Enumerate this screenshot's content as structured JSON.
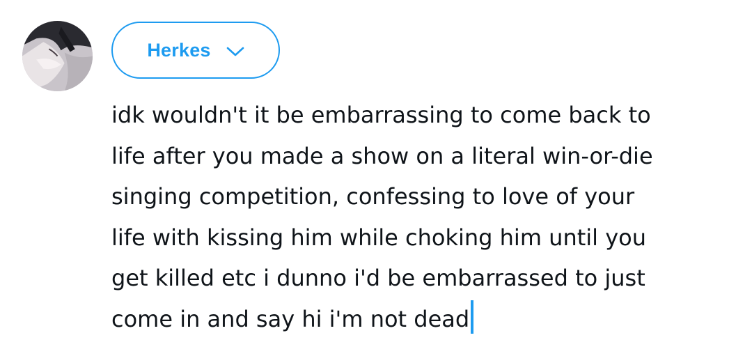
{
  "composer": {
    "audience_label": "Herkes",
    "text_lines": [
      "idk wouldn't it be embarrassing to come back to",
      "life after you made a show on a literal win-or-die",
      "singing competition, confessing to love of your",
      "life with kissing him while choking him until you",
      "get killed etc i dunno i'd be embarrassed to just",
      "come in and say hi i'm not dead"
    ]
  },
  "colors": {
    "accent": "#1d9bf0",
    "text": "#0f1419",
    "background": "#ffffff"
  },
  "icons": {
    "audience_dropdown": "chevron-down-icon",
    "avatar": "user-avatar"
  }
}
